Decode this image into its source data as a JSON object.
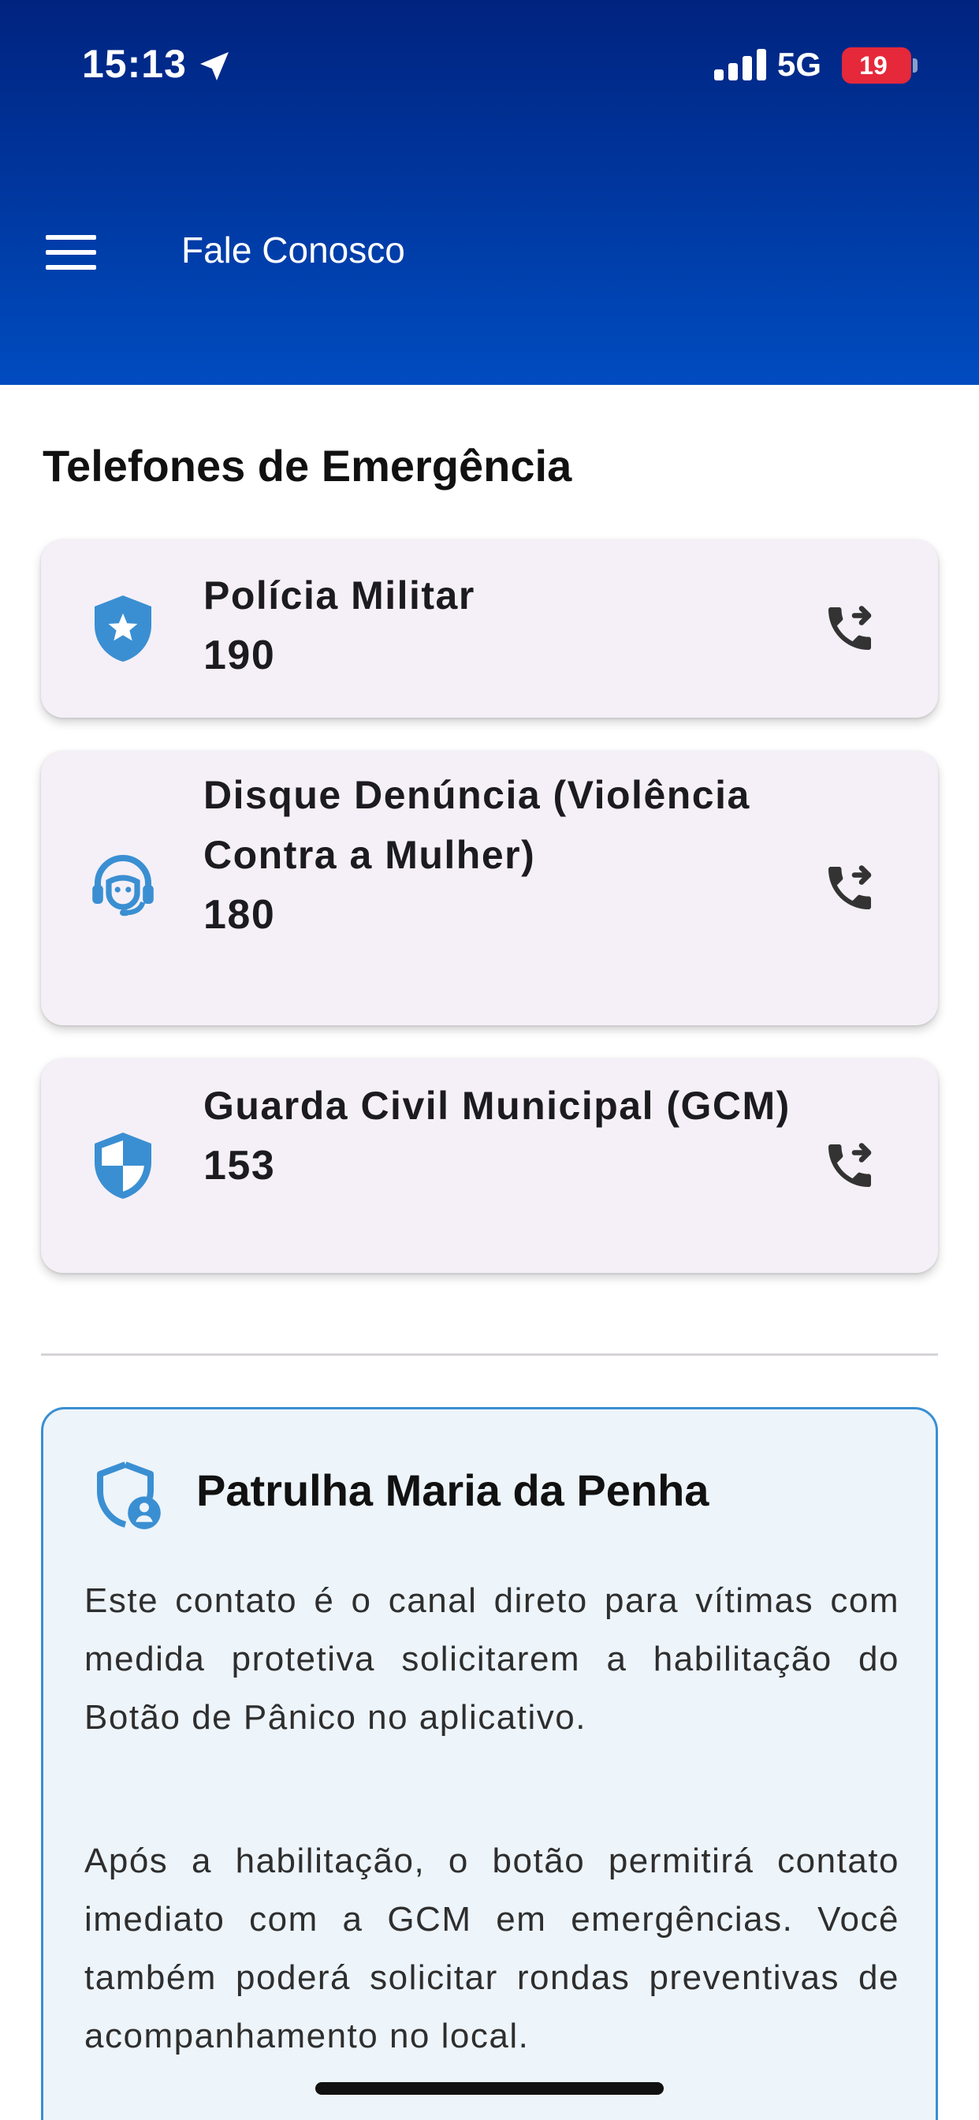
{
  "status_bar": {
    "time": "15:13",
    "network": "5G",
    "battery": "19",
    "icons": [
      "location-arrow-icon",
      "signal-bars-icon",
      "battery-charging-icon"
    ]
  },
  "app_bar": {
    "title": "Fale Conosco",
    "menu_icon": "hamburger-menu-icon"
  },
  "emergency": {
    "heading": "Telefones de Emergência",
    "contacts": [
      {
        "name": "Polícia Militar",
        "number": "190",
        "icon": "police-shield-star-icon",
        "action_icon": "phone-forward-icon"
      },
      {
        "name": "Disque Denúncia (Violência Contra a Mulher)",
        "number": "180",
        "icon": "support-agent-icon",
        "action_icon": "phone-forward-icon"
      },
      {
        "name": "Guarda Civil Municipal (GCM)",
        "number": "153",
        "icon": "security-shield-icon",
        "action_icon": "phone-forward-icon"
      }
    ]
  },
  "patrol": {
    "title": "Patrulha Maria da Penha",
    "icon": "shield-person-icon",
    "paragraphs": [
      "Este contato é o canal direto para vítimas com medida protetiva solicitarem a habilitação do Botão de Pânico no aplicativo.",
      "Após a habilitação, o botão permitirá contato imediato com a GCM em emergências. Você também poderá solicitar rondas preventivas de acompanhamento no local."
    ]
  },
  "colors": {
    "header_top": "#00237f",
    "header_bottom": "#004cc0",
    "icon_blue": "#3a8fd2",
    "card_bg": "#f5f0f7",
    "info_bg": "#edf4fa",
    "battery_red": "#e5283a"
  }
}
